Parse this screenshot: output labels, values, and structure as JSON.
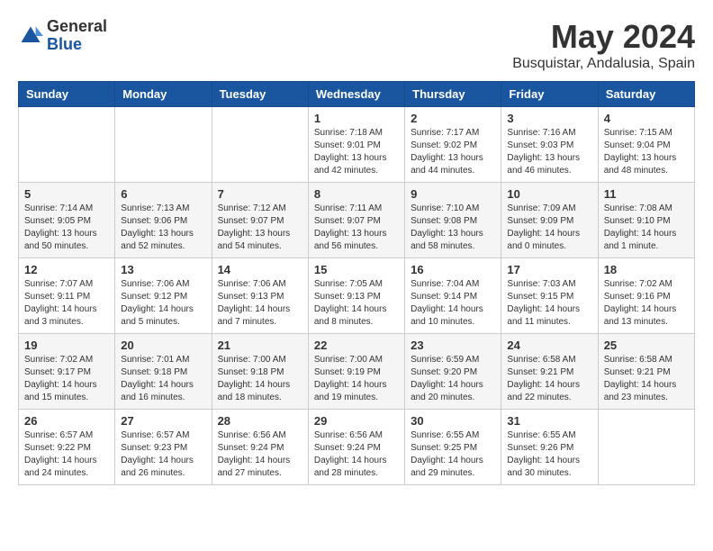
{
  "logo": {
    "general": "General",
    "blue": "Blue"
  },
  "title": "May 2024",
  "location": "Busquistar, Andalusia, Spain",
  "days_header": [
    "Sunday",
    "Monday",
    "Tuesday",
    "Wednesday",
    "Thursday",
    "Friday",
    "Saturday"
  ],
  "weeks": [
    [
      {
        "day": "",
        "info": ""
      },
      {
        "day": "",
        "info": ""
      },
      {
        "day": "",
        "info": ""
      },
      {
        "day": "1",
        "info": "Sunrise: 7:18 AM\nSunset: 9:01 PM\nDaylight: 13 hours\nand 42 minutes."
      },
      {
        "day": "2",
        "info": "Sunrise: 7:17 AM\nSunset: 9:02 PM\nDaylight: 13 hours\nand 44 minutes."
      },
      {
        "day": "3",
        "info": "Sunrise: 7:16 AM\nSunset: 9:03 PM\nDaylight: 13 hours\nand 46 minutes."
      },
      {
        "day": "4",
        "info": "Sunrise: 7:15 AM\nSunset: 9:04 PM\nDaylight: 13 hours\nand 48 minutes."
      }
    ],
    [
      {
        "day": "5",
        "info": "Sunrise: 7:14 AM\nSunset: 9:05 PM\nDaylight: 13 hours\nand 50 minutes."
      },
      {
        "day": "6",
        "info": "Sunrise: 7:13 AM\nSunset: 9:06 PM\nDaylight: 13 hours\nand 52 minutes."
      },
      {
        "day": "7",
        "info": "Sunrise: 7:12 AM\nSunset: 9:07 PM\nDaylight: 13 hours\nand 54 minutes."
      },
      {
        "day": "8",
        "info": "Sunrise: 7:11 AM\nSunset: 9:07 PM\nDaylight: 13 hours\nand 56 minutes."
      },
      {
        "day": "9",
        "info": "Sunrise: 7:10 AM\nSunset: 9:08 PM\nDaylight: 13 hours\nand 58 minutes."
      },
      {
        "day": "10",
        "info": "Sunrise: 7:09 AM\nSunset: 9:09 PM\nDaylight: 14 hours\nand 0 minutes."
      },
      {
        "day": "11",
        "info": "Sunrise: 7:08 AM\nSunset: 9:10 PM\nDaylight: 14 hours\nand 1 minute."
      }
    ],
    [
      {
        "day": "12",
        "info": "Sunrise: 7:07 AM\nSunset: 9:11 PM\nDaylight: 14 hours\nand 3 minutes."
      },
      {
        "day": "13",
        "info": "Sunrise: 7:06 AM\nSunset: 9:12 PM\nDaylight: 14 hours\nand 5 minutes."
      },
      {
        "day": "14",
        "info": "Sunrise: 7:06 AM\nSunset: 9:13 PM\nDaylight: 14 hours\nand 7 minutes."
      },
      {
        "day": "15",
        "info": "Sunrise: 7:05 AM\nSunset: 9:13 PM\nDaylight: 14 hours\nand 8 minutes."
      },
      {
        "day": "16",
        "info": "Sunrise: 7:04 AM\nSunset: 9:14 PM\nDaylight: 14 hours\nand 10 minutes."
      },
      {
        "day": "17",
        "info": "Sunrise: 7:03 AM\nSunset: 9:15 PM\nDaylight: 14 hours\nand 11 minutes."
      },
      {
        "day": "18",
        "info": "Sunrise: 7:02 AM\nSunset: 9:16 PM\nDaylight: 14 hours\nand 13 minutes."
      }
    ],
    [
      {
        "day": "19",
        "info": "Sunrise: 7:02 AM\nSunset: 9:17 PM\nDaylight: 14 hours\nand 15 minutes."
      },
      {
        "day": "20",
        "info": "Sunrise: 7:01 AM\nSunset: 9:18 PM\nDaylight: 14 hours\nand 16 minutes."
      },
      {
        "day": "21",
        "info": "Sunrise: 7:00 AM\nSunset: 9:18 PM\nDaylight: 14 hours\nand 18 minutes."
      },
      {
        "day": "22",
        "info": "Sunrise: 7:00 AM\nSunset: 9:19 PM\nDaylight: 14 hours\nand 19 minutes."
      },
      {
        "day": "23",
        "info": "Sunrise: 6:59 AM\nSunset: 9:20 PM\nDaylight: 14 hours\nand 20 minutes."
      },
      {
        "day": "24",
        "info": "Sunrise: 6:58 AM\nSunset: 9:21 PM\nDaylight: 14 hours\nand 22 minutes."
      },
      {
        "day": "25",
        "info": "Sunrise: 6:58 AM\nSunset: 9:21 PM\nDaylight: 14 hours\nand 23 minutes."
      }
    ],
    [
      {
        "day": "26",
        "info": "Sunrise: 6:57 AM\nSunset: 9:22 PM\nDaylight: 14 hours\nand 24 minutes."
      },
      {
        "day": "27",
        "info": "Sunrise: 6:57 AM\nSunset: 9:23 PM\nDaylight: 14 hours\nand 26 minutes."
      },
      {
        "day": "28",
        "info": "Sunrise: 6:56 AM\nSunset: 9:24 PM\nDaylight: 14 hours\nand 27 minutes."
      },
      {
        "day": "29",
        "info": "Sunrise: 6:56 AM\nSunset: 9:24 PM\nDaylight: 14 hours\nand 28 minutes."
      },
      {
        "day": "30",
        "info": "Sunrise: 6:55 AM\nSunset: 9:25 PM\nDaylight: 14 hours\nand 29 minutes."
      },
      {
        "day": "31",
        "info": "Sunrise: 6:55 AM\nSunset: 9:26 PM\nDaylight: 14 hours\nand 30 minutes."
      },
      {
        "day": "",
        "info": ""
      }
    ]
  ]
}
